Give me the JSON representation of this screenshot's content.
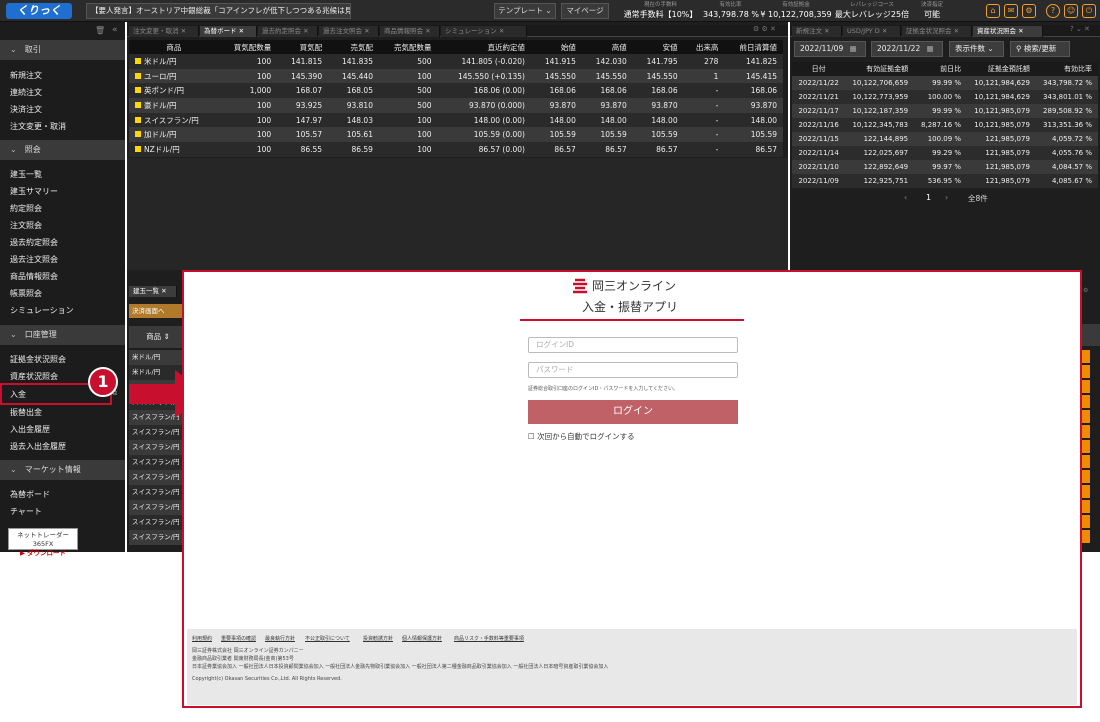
{
  "topbar": {
    "logo": "くりっく365",
    "news": "【要人発言】オーストリア中銀総裁「コアインフレが低下しつつある兆候は見ら…",
    "template_btn": "テンプレート ⌄",
    "mypage_btn": "マイページ",
    "stats": [
      {
        "label": "現在の手数料",
        "value": "通常手数料【10%】"
      },
      {
        "label": "有効比率",
        "value": "343,798.78 %"
      },
      {
        "label": "有効証拠金",
        "value": "¥ 10,122,708,359"
      },
      {
        "label": "レバレッジコース",
        "value": "最大レバレッジ25倍"
      },
      {
        "label": "決済指定",
        "value": "可能"
      }
    ],
    "icons": [
      "home-icon",
      "mail-icon",
      "gear-icon",
      "help-icon",
      "user-icon",
      "logout-icon"
    ]
  },
  "sidebar": {
    "sections": [
      {
        "title": "取引",
        "items": [
          "新規注文",
          "連続注文",
          "決済注文",
          "注文変更・取消"
        ]
      },
      {
        "title": "照会",
        "items": [
          "建玉一覧",
          "建玉サマリー",
          "約定照会",
          "注文照会",
          "過去約定照会",
          "過去注文照会",
          "商品情報照会",
          "帳票照会",
          "シミュレーション"
        ]
      },
      {
        "title": "口座管理",
        "items": [
          "証拠金状況照会",
          "資産状況照会",
          "入金",
          "振替出金",
          "入出金履歴",
          "過去入出金履歴"
        ]
      },
      {
        "title": "マーケット情報",
        "items": [
          "為替ボード",
          "チャート"
        ]
      }
    ],
    "download_top": "ネットトレーダー365FX",
    "download_label": "ダウンロード"
  },
  "center_tabs": [
    "注文変更・取消",
    "為替ボード",
    "過去約定照会",
    "過去注文照会",
    "商品情報照会",
    "シミュレーション"
  ],
  "fx_board": {
    "columns": [
      "商品",
      "買気配数量",
      "買気配",
      "売気配",
      "売気配数量",
      "直近約定値",
      "始値",
      "高値",
      "安値",
      "出来高",
      "前日清算値"
    ],
    "rows": [
      [
        "米ドル/円",
        "100",
        "141.815",
        "141.835",
        "500",
        "141.805 (-0.020)",
        "141.915",
        "142.030",
        "141.795",
        "278",
        "141.825"
      ],
      [
        "ユーロ/円",
        "100",
        "145.390",
        "145.440",
        "100",
        "145.550 (+0.135)",
        "145.550",
        "145.550",
        "145.550",
        "1",
        "145.415"
      ],
      [
        "英ポンド/円",
        "1,000",
        "168.07",
        "168.05",
        "500",
        "168.06 (0.00)",
        "168.06",
        "168.06",
        "168.06",
        "-",
        "168.06"
      ],
      [
        "豪ドル/円",
        "100",
        "93.925",
        "93.810",
        "500",
        "93.870 (0.000)",
        "93.870",
        "93.870",
        "93.870",
        "-",
        "93.870"
      ],
      [
        "スイスフラン/円",
        "100",
        "147.97",
        "148.03",
        "100",
        "148.00 (0.00)",
        "148.00",
        "148.00",
        "148.00",
        "-",
        "148.00"
      ],
      [
        "加ドル/円",
        "100",
        "105.57",
        "105.61",
        "100",
        "105.59 (0.00)",
        "105.59",
        "105.59",
        "105.59",
        "-",
        "105.59"
      ],
      [
        "NZドル/円",
        "100",
        "86.55",
        "86.59",
        "100",
        "86.57 (0.00)",
        "86.57",
        "86.57",
        "86.57",
        "-",
        "86.57"
      ]
    ]
  },
  "right_tabs": [
    "新規注文",
    "USD/JPY D",
    "証拠金状況照会",
    "資産状況照会"
  ],
  "asset": {
    "date_from": "2022/11/09",
    "date_to": "2022/11/22",
    "count_label": "表示件数 ⌄",
    "search_label": "検索/更新",
    "columns": [
      "日付",
      "有効証拠金額",
      "前日比",
      "証拠金預託額",
      "有効比率"
    ],
    "rows": [
      [
        "2022/11/22",
        "10,122,706,659",
        "99.99 %",
        "10,121,984,629",
        "343,798.72 %"
      ],
      [
        "2022/11/21",
        "10,122,773,959",
        "100.00 %",
        "10,121,984,629",
        "343,801.01 %"
      ],
      [
        "2022/11/17",
        "10,122,187,359",
        "99.99 %",
        "10,121,985,079",
        "289,508.92 %"
      ],
      [
        "2022/11/16",
        "10,122,345,783",
        "8,287.16 %",
        "10,121,985,079",
        "313,351.36 %"
      ],
      [
        "2022/11/15",
        "122,144,895",
        "100.09 %",
        "121,985,079",
        "4,059.72 %"
      ],
      [
        "2022/11/14",
        "122,025,697",
        "99.29 %",
        "121,985,079",
        "4,055.76 %"
      ],
      [
        "2022/11/10",
        "122,892,649",
        "99.97 %",
        "121,985,079",
        "4,084.57 %"
      ],
      [
        "2022/11/09",
        "122,925,751",
        "536.95 %",
        "121,985,079",
        "4,085.67 %"
      ]
    ],
    "page": "1",
    "total": "全8件"
  },
  "positions": {
    "tab": "建玉一覧",
    "settle_btn": "決済画面へ",
    "header": "商品 ⇕",
    "rows": [
      "米ドル/円",
      "米ドル/円",
      "スイスフラン/円",
      "スイスフラン/円",
      "スイスフラン/円",
      "スイスフラン/円",
      "スイスフラン/円",
      "スイスフラン/円",
      "スイスフラン/円",
      "スイスフラン/円",
      "スイスフラン/円",
      "スイスフラン/円",
      "スイスフラン/円"
    ]
  },
  "login": {
    "brand": "岡三オンライン",
    "app_title": "入金・振替アプリ",
    "id_placeholder": "ログインID",
    "pw_placeholder": "パスワード",
    "hint": "証券総合取引口座のログインID・パスワードを入力してください。",
    "button": "ログイン",
    "auto_login": "次回から自動でログインする",
    "footer_links": [
      "利用規約",
      "重要事項の確認",
      "最良執行方針",
      "不公正取引について",
      "投資勧誘方針",
      "個人情報保護方針",
      "商品リスク・手数料等重要事項"
    ],
    "footer_lines": [
      "岡三証券株式会社 岡三オンライン証券カンパニー",
      "金融商品取引業者 関東財務局長(金商)第53号",
      "日本証券業協会加入 一般社団法人日本投資顧問業協会加入 一般社団法人金融先物取引業協会加入 一般社団法人第二種金融商品取引業協会加入 一般社団法人日本暗号資産取引業協会加入"
    ],
    "copyright": "Copyright(c) Okasan Securities Co.,Ltd. All Rights Reserved."
  },
  "callout_number": "1",
  "colors": {
    "bid": "#2fd0a0",
    "ask": "#ff5a7a",
    "accent": "#c8102e",
    "login_button": "#c06168"
  }
}
